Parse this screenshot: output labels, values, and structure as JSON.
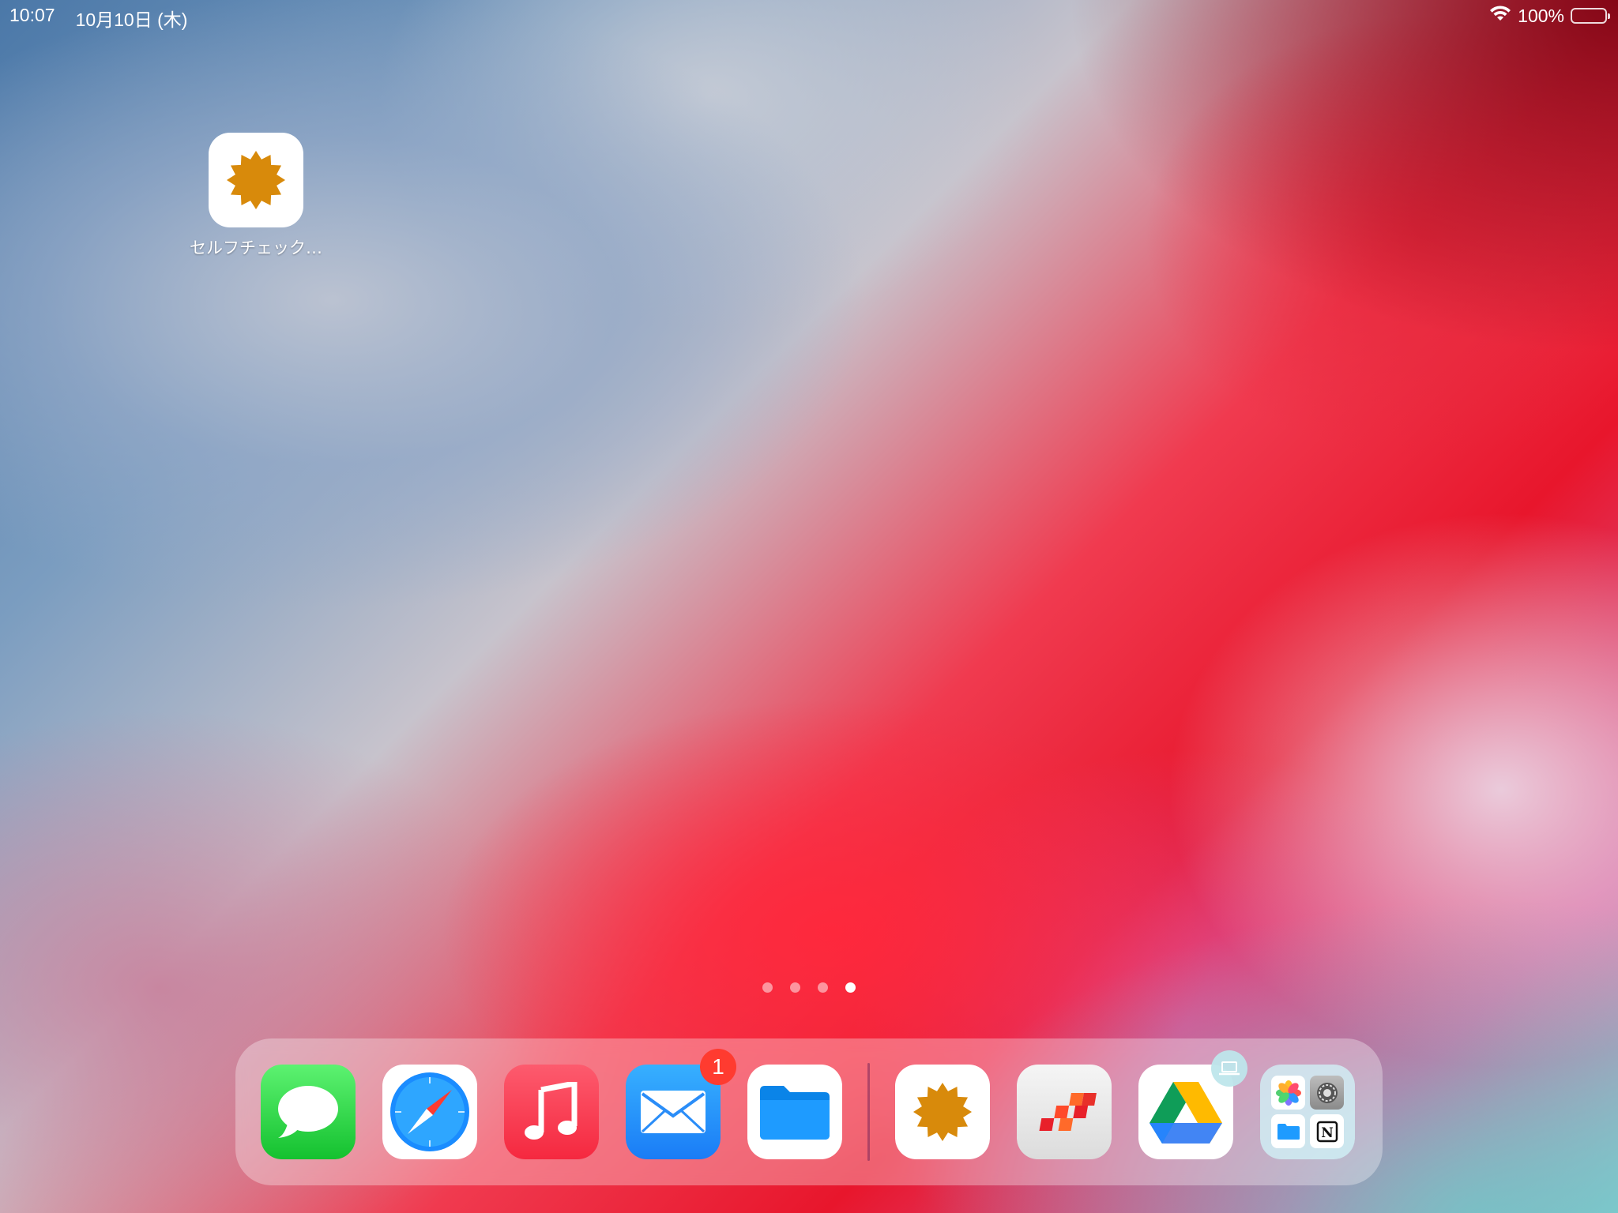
{
  "status_bar": {
    "time": "10:07",
    "date": "10月10日 (木)",
    "battery_percent": "100%",
    "battery_level": 1.0
  },
  "home_apps": [
    {
      "label": "セルフチェック…",
      "icon": "orange-starburst-icon"
    }
  ],
  "page_dots": {
    "count": 4,
    "active_index": 3
  },
  "dock": {
    "apps": [
      {
        "name": "messages-app",
        "icon": "speech-bubble-icon"
      },
      {
        "name": "safari-app",
        "icon": "compass-icon"
      },
      {
        "name": "music-app",
        "icon": "music-note-icon"
      },
      {
        "name": "mail-app",
        "icon": "envelope-icon",
        "badge": "1"
      },
      {
        "name": "files-app",
        "icon": "folder-icon"
      }
    ],
    "recent_apps": [
      {
        "name": "self-check-app",
        "icon": "orange-starburst-icon"
      },
      {
        "name": "red-checker-app",
        "icon": "checker-flag-icon"
      },
      {
        "name": "google-drive-app",
        "icon": "drive-triangle-icon",
        "badge_icon": "laptop-icon"
      },
      {
        "name": "app-folder",
        "icon": "folder-grid-icon",
        "contents": [
          "photos-icon",
          "settings-icon",
          "files-icon",
          "notion-icon"
        ]
      }
    ]
  },
  "colors": {
    "badge": "#ff3b30",
    "starburst": "#d88a0b",
    "messages_green": "#2ecc40",
    "mail_blue": "#1a8cff",
    "music_red": "#fa3c50"
  }
}
